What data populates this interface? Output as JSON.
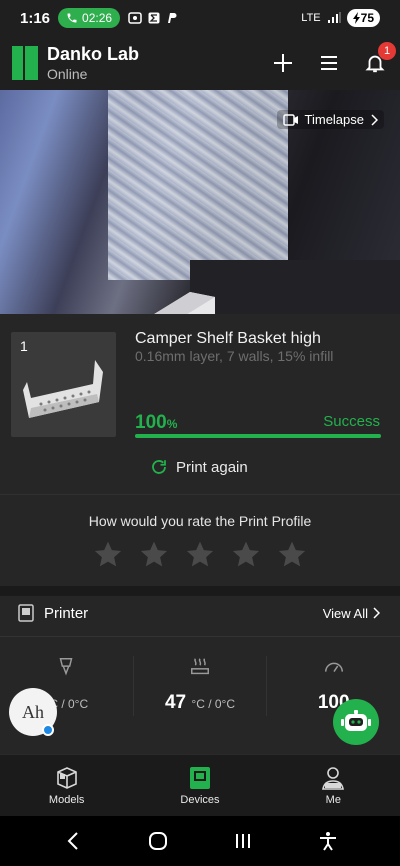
{
  "status_bar": {
    "time": "1:16",
    "call_timer": "02:26",
    "network": "LTE",
    "battery": "75"
  },
  "header": {
    "title": "Danko Lab",
    "status": "Online",
    "notification_count": "1"
  },
  "camera": {
    "timelapse_label": "Timelapse"
  },
  "job": {
    "index": "1",
    "name": "Camper Shelf Basket high",
    "details": "0.16mm layer, 7 walls, 15% infill",
    "progress_value": "100",
    "progress_unit": "%",
    "progress_fraction": 1.0,
    "status": "Success",
    "print_again": "Print again"
  },
  "rating": {
    "title": "How would you rate the Print Profile",
    "stars_total": 5,
    "stars_filled": 0
  },
  "printer": {
    "title": "Printer",
    "view_all": "View All",
    "temps": [
      {
        "value": "",
        "unit": "°C / 0°C"
      },
      {
        "value": "47",
        "unit": "°C / 0°C"
      },
      {
        "value": "100",
        "unit": ""
      }
    ]
  },
  "float_left": {
    "text": "Ah"
  },
  "nav": {
    "items": [
      {
        "label": "Models"
      },
      {
        "label": "Devices"
      },
      {
        "label": "Me"
      }
    ]
  },
  "colors": {
    "accent": "#22b14c",
    "background": "#1f1f1f",
    "card": "#262626",
    "badge": "#e53935"
  }
}
